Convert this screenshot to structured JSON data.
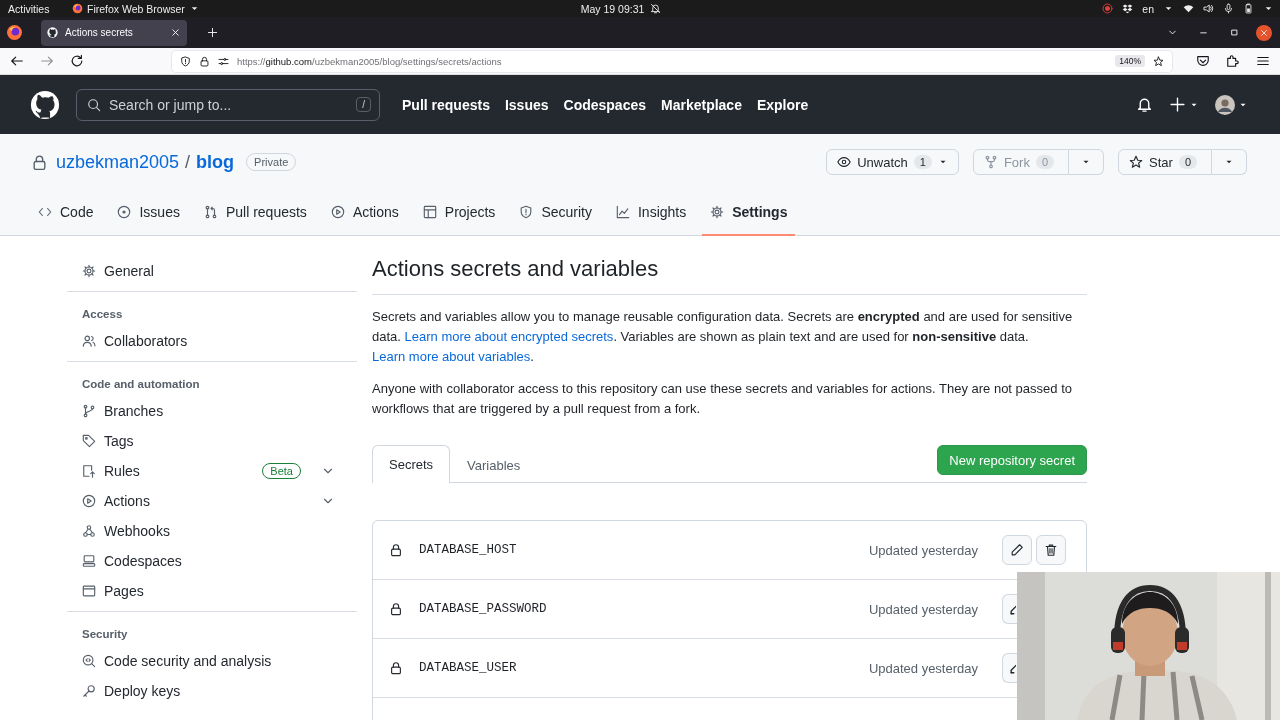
{
  "os_bar": {
    "activities": "Activities",
    "app": "Firefox Web Browser",
    "clock": "May 19  09:31",
    "language": "en"
  },
  "browser": {
    "tabs": [
      {
        "title": "Actions secrets",
        "selected": true
      }
    ],
    "url": {
      "scheme": "https://",
      "host": "github.com",
      "path": "/uzbekman2005/blog/settings/secrets/actions"
    },
    "zoom": "140%"
  },
  "github_header": {
    "search_placeholder": "Search or jump to...",
    "shortcut": "/",
    "nav": [
      "Pull requests",
      "Issues",
      "Codespaces",
      "Marketplace",
      "Explore"
    ]
  },
  "repo": {
    "owner": "uzbekman2005",
    "separator": "/",
    "name": "blog",
    "visibility": "Private",
    "buttons": [
      {
        "kind": "watch",
        "label": "Unwatch",
        "count": "1",
        "disabled": false,
        "split": false
      },
      {
        "kind": "fork",
        "label": "Fork",
        "count": "0",
        "disabled": true,
        "split": true
      },
      {
        "kind": "star",
        "label": "Star",
        "count": "0",
        "disabled": false,
        "split": true
      }
    ],
    "tabs": [
      {
        "label": "Code",
        "selected": false
      },
      {
        "label": "Issues",
        "selected": false
      },
      {
        "label": "Pull requests",
        "selected": false
      },
      {
        "label": "Actions",
        "selected": false
      },
      {
        "label": "Projects",
        "selected": false
      },
      {
        "label": "Security",
        "selected": false
      },
      {
        "label": "Insights",
        "selected": false
      },
      {
        "label": "Settings",
        "selected": true
      }
    ]
  },
  "sidebar": {
    "sections": [
      {
        "items": [
          {
            "label": "General",
            "selected": false
          }
        ]
      },
      {
        "heading": "Access",
        "items": [
          {
            "label": "Collaborators",
            "selected": false
          }
        ]
      },
      {
        "heading": "Code and automation",
        "items": [
          {
            "label": "Branches",
            "selected": false
          },
          {
            "label": "Tags",
            "selected": false
          },
          {
            "label": "Rules",
            "badge": "Beta",
            "expandable": true,
            "selected": false
          },
          {
            "label": "Actions",
            "expandable": true,
            "selected": false
          },
          {
            "label": "Webhooks",
            "selected": false
          },
          {
            "label": "Codespaces",
            "selected": false
          },
          {
            "label": "Pages",
            "selected": false
          }
        ]
      },
      {
        "heading": "Security",
        "items": [
          {
            "label": "Code security and analysis",
            "selected": false
          },
          {
            "label": "Deploy keys",
            "selected": false
          }
        ]
      }
    ]
  },
  "content": {
    "title": "Actions secrets and variables",
    "paragraphs": [
      [
        {
          "kind": "text",
          "text": "Secrets and variables allow you to manage reusable configuration data. Secrets are **encrypted** and are used for sensitive data. "
        },
        {
          "kind": "link",
          "text": "Learn more about encrypted secrets"
        },
        {
          "kind": "text",
          "text": ". Variables are shown as plain text and are used for **non-sensitive** data. "
        },
        {
          "kind": "link",
          "text": "Learn more about variables"
        },
        {
          "kind": "text",
          "text": "."
        }
      ],
      [
        {
          "kind": "text",
          "text": "Anyone with collaborator access to this repository can use these secrets and variables for actions. They are not passed to workflows that are triggered by a pull request from a fork."
        }
      ]
    ],
    "tabs": [
      {
        "label": "Secrets",
        "selected": true
      },
      {
        "label": "Variables",
        "selected": false
      }
    ],
    "new_button": "New repository secret",
    "secrets": [
      {
        "name": "DATABASE_HOST",
        "updated": "Updated yesterday"
      },
      {
        "name": "DATABASE_PASSWORD",
        "updated": "Updated yesterday"
      },
      {
        "name": "DATABASE_USER",
        "updated": "Updated yesterday"
      }
    ],
    "more_rows": true
  }
}
